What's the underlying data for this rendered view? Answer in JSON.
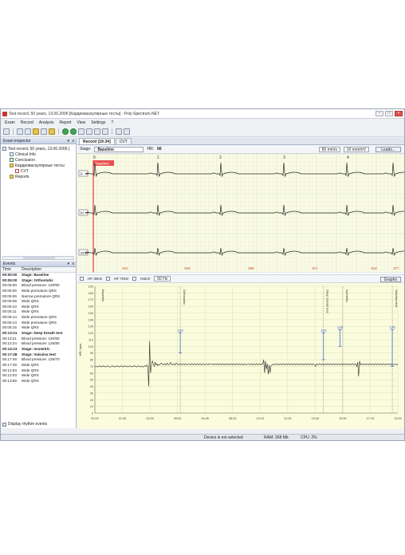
{
  "window": {
    "title": "Test record, 50 years, 13.06.2006 [Кардиоваскулярные тесты] - Poly-Spectrum.NET",
    "buttons": {
      "min": "–",
      "max": "□",
      "close": "×"
    }
  },
  "menu": [
    "Exam",
    "Record",
    "Analysis",
    "Report",
    "View",
    "Settings",
    "?"
  ],
  "exam_inspector": {
    "title": "Exam inspector",
    "pin": "▾",
    "close": "x",
    "tree": [
      {
        "label": "Test record, 50 years, 13.06.2006 [",
        "icon": "patient-icon",
        "kind": "root"
      },
      {
        "label": "Clinical Info",
        "icon": "document-icon",
        "kind": "doc"
      },
      {
        "label": "Conclusion",
        "icon": "checklist-icon",
        "kind": "chk"
      },
      {
        "label": "Кардиоваскулярные тесты",
        "icon": "folder-icon",
        "kind": "fold"
      },
      {
        "label": "CVT",
        "icon": "cvt-icon",
        "kind": "red"
      },
      {
        "label": "Reports",
        "icon": "reports-icon",
        "kind": "fold"
      }
    ]
  },
  "events": {
    "title": "Events",
    "col_time": "Time",
    "col_desc": "Description",
    "rows": [
      {
        "t": "00:00:00",
        "d": "Stage: Baseline",
        "bold": true
      },
      {
        "t": "00:05:00",
        "d": "Stage: Orthostatic",
        "bold": true
      },
      {
        "t": "00:05:00",
        "d": "Blood pressure: 120/90"
      },
      {
        "t": "00:05:06",
        "d": "Wide premature QRS"
      },
      {
        "t": "00:05:06",
        "d": "Narrow premature QRS"
      },
      {
        "t": "00:05:08",
        "d": "Wide QRS"
      },
      {
        "t": "00:05:10",
        "d": "Wide QRS"
      },
      {
        "t": "00:05:11",
        "d": "Wide QRS"
      },
      {
        "t": "00:05:14",
        "d": "Wide premature QRS"
      },
      {
        "t": "00:05:14",
        "d": "Wide premature QRS"
      },
      {
        "t": "00:05:16",
        "d": "Wide QRS"
      },
      {
        "t": "00:13:21",
        "d": "Stage: Deep breath test",
        "bold": true
      },
      {
        "t": "00:13:21",
        "d": "Blood pressure: 120/80"
      },
      {
        "t": "00:13:24",
        "d": "Blood pressure: 125/80"
      },
      {
        "t": "00:14:23",
        "d": "Stage: Isometric",
        "bold": true
      },
      {
        "t": "00:17:48",
        "d": "Stage: Valsalva test",
        "bold": true
      },
      {
        "t": "00:17:48",
        "d": "Blood pressure: 125/70"
      },
      {
        "t": "00:17:49",
        "d": "Wide QRS"
      },
      {
        "t": "00:12:03",
        "d": "Wide QRS"
      },
      {
        "t": "00:12:03",
        "d": "Wide QRS"
      },
      {
        "t": "00:13:59",
        "d": "Wide QRS"
      }
    ],
    "display_rhythm": "Display rhythm events"
  },
  "tabs": [
    {
      "label": "Record [19:34]",
      "active": true
    },
    {
      "label": "CVT",
      "active": false
    }
  ],
  "stage_bar": {
    "stage_label": "Stage:",
    "stage_value": "Baseline",
    "hr_label": "HR:",
    "hr_value": "66",
    "speed": "50 mm/s",
    "gain": "10 mm/mV",
    "leads_btn": "Leads..."
  },
  "ecg": {
    "beat_numbers": [
      "0",
      "1",
      "2",
      "3",
      "4"
    ],
    "lead_labels": [
      "II",
      "III",
      "aVL"
    ],
    "baseline_marker": "Baseline",
    "rr_values": [
      "912",
      "849",
      "999",
      "917",
      "918",
      "577"
    ]
  },
  "filter_bar": {
    "hf35": "HF 35Hz",
    "hf75": "HF 75Hz",
    "notch": "Notch",
    "hz": "50 Hz",
    "graphs_btn": "Graphs"
  },
  "status": {
    "device": "Device is not selected",
    "ram": "RAM: 268 Mb",
    "cpu": "CPU: 2%"
  },
  "chart_data": {
    "type": "line",
    "ylabel": "HR, bpm",
    "ylim": [
      0,
      190
    ],
    "y_ticks": [
      0,
      10,
      20,
      30,
      40,
      50,
      60,
      70,
      80,
      90,
      100,
      110,
      120,
      130,
      140,
      150,
      160,
      170,
      180,
      190
    ],
    "x_ticks": [
      "00:00",
      "01:45",
      "03:30",
      "05:00",
      "06:45",
      "08:30",
      "10:15",
      "12:00",
      "13:45",
      "15:30",
      "17:15",
      "19:00"
    ],
    "stage_labels": [
      "Baseline",
      "Orthostatic",
      "Deep breath test",
      "Isometric",
      "Valsalva test"
    ],
    "annotations": [
      {
        "label": "120",
        "bp_high": 120,
        "bp_low": 90
      },
      {
        "label": "120",
        "bp_high": 120,
        "bp_low": 80
      },
      {
        "label": "125",
        "bp_high": 125,
        "bp_low": 100
      },
      {
        "label": "125",
        "bp_high": 125,
        "bp_low": 70
      }
    ],
    "series": [
      {
        "values": [
          69,
          70,
          70,
          69,
          70,
          71,
          70,
          69,
          70,
          71,
          70,
          70,
          69,
          70,
          71,
          70,
          69,
          69,
          70,
          71,
          70,
          70,
          69,
          70,
          71,
          70,
          70,
          69,
          70,
          71,
          70,
          69,
          70,
          71,
          70,
          70,
          69,
          70,
          71,
          70,
          69,
          70,
          70,
          71,
          70,
          70,
          69,
          70,
          71,
          70,
          69,
          70,
          70,
          69,
          70,
          71,
          70,
          72,
          70,
          40,
          108,
          60,
          72,
          78,
          74,
          70,
          76,
          72,
          74,
          71,
          73,
          72,
          74,
          75,
          73,
          72,
          74,
          73,
          72,
          75,
          73,
          72,
          74,
          76,
          73,
          72,
          74,
          73,
          72,
          75,
          74,
          73,
          72,
          74,
          73,
          72,
          74,
          73,
          72,
          74,
          73,
          72,
          73,
          74,
          73,
          72,
          74,
          73,
          72,
          74,
          73,
          72,
          74,
          73,
          72,
          74,
          73,
          72,
          74,
          73,
          72,
          73,
          74,
          73,
          72,
          74,
          73,
          73,
          74,
          73,
          72,
          74,
          73,
          72,
          74,
          73,
          72,
          74,
          73,
          72,
          74,
          73,
          72,
          74,
          73,
          72,
          74,
          73,
          72,
          74,
          73,
          72,
          74,
          73,
          72,
          74,
          73,
          72,
          74,
          73,
          72,
          74,
          73,
          72,
          74,
          73,
          72,
          73,
          74,
          73,
          72,
          74,
          73,
          72,
          74,
          73,
          72,
          74,
          73,
          72,
          74,
          73,
          72,
          74,
          73,
          80,
          60,
          78,
          66,
          74,
          58,
          72,
          60,
          71,
          72,
          73,
          72,
          74,
          73,
          72,
          74,
          73,
          72,
          74,
          73,
          72,
          74,
          73,
          72,
          74,
          73,
          72,
          74,
          73,
          72,
          74,
          73,
          72,
          74,
          73,
          72,
          74,
          73,
          72,
          74,
          73,
          72,
          74,
          73,
          72,
          74,
          73,
          72,
          74,
          73,
          72,
          74,
          73,
          72,
          74,
          73,
          72,
          70,
          74,
          73,
          72,
          74,
          73,
          72,
          74,
          73,
          72,
          74,
          73,
          72,
          74,
          73,
          72,
          74,
          73,
          72,
          74,
          73,
          72,
          74,
          73,
          72,
          74,
          73,
          72,
          74,
          73,
          72,
          74,
          73,
          72,
          74,
          73,
          72,
          74,
          73,
          72,
          74,
          73,
          72,
          74,
          73,
          70,
          76,
          55,
          78,
          72,
          74,
          73,
          72,
          74,
          73,
          72,
          74,
          73,
          72,
          74,
          73,
          72,
          74,
          73,
          72,
          74,
          73,
          72,
          74,
          73,
          72,
          74,
          73,
          72,
          74,
          73,
          72,
          74,
          73,
          72,
          74,
          73,
          72,
          74,
          73,
          72,
          73,
          74,
          73,
          72,
          74
        ]
      }
    ]
  }
}
